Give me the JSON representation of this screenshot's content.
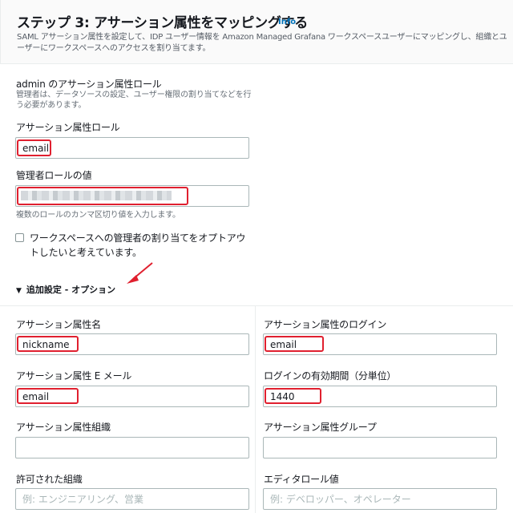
{
  "header": {
    "title": "ステップ 3: アサーション属性をマッピングする",
    "info_label": "Info",
    "description": "SAML アサーション属性を設定して、IDP ユーザー情報を Amazon Managed Grafana ワークスペースユーザーにマッピングし、組織とユーザーにワークスペースへのアクセスを割り当てます。"
  },
  "admin_section": {
    "title": "admin のアサーション属性ロール",
    "description": "管理者は、データソースの設定、ユーザー権限の割り当てなどを行う必要があります。",
    "assertion_role_label": "アサーション属性ロール",
    "assertion_role_value": "email",
    "admin_role_values_label": "管理者ロールの値",
    "admin_role_values_value": "redacted",
    "admin_role_values_hint": "複数のロールのカンマ区切り値を入力します。",
    "optout_label": "ワークスペースへの管理者の割り当てをオプトアウトしたいと考えています。"
  },
  "additional_settings": {
    "label": "追加設定 - オプション",
    "caret": "▼",
    "fields": {
      "name_label": "アサーション属性名",
      "name_value": "nickname",
      "login_label": "アサーション属性のログイン",
      "login_value": "email",
      "email_label": "アサーション属性 E メール",
      "email_value": "email",
      "login_validity_label": "ログインの有効期間（分単位）",
      "login_validity_value": "1440",
      "org_label": "アサーション属性組織",
      "org_value": "",
      "groups_label": "アサーション属性グループ",
      "groups_value": "",
      "allowed_orgs_label": "許可された組織",
      "allowed_orgs_placeholder": "例: エンジニアリング、営業",
      "editor_role_label": "エディタロール値",
      "editor_role_placeholder": "例: デベロッパー、オペレーター"
    }
  },
  "colors": {
    "highlight": "#e0202f",
    "link": "#0073bb",
    "arrow": "#e0202f"
  }
}
